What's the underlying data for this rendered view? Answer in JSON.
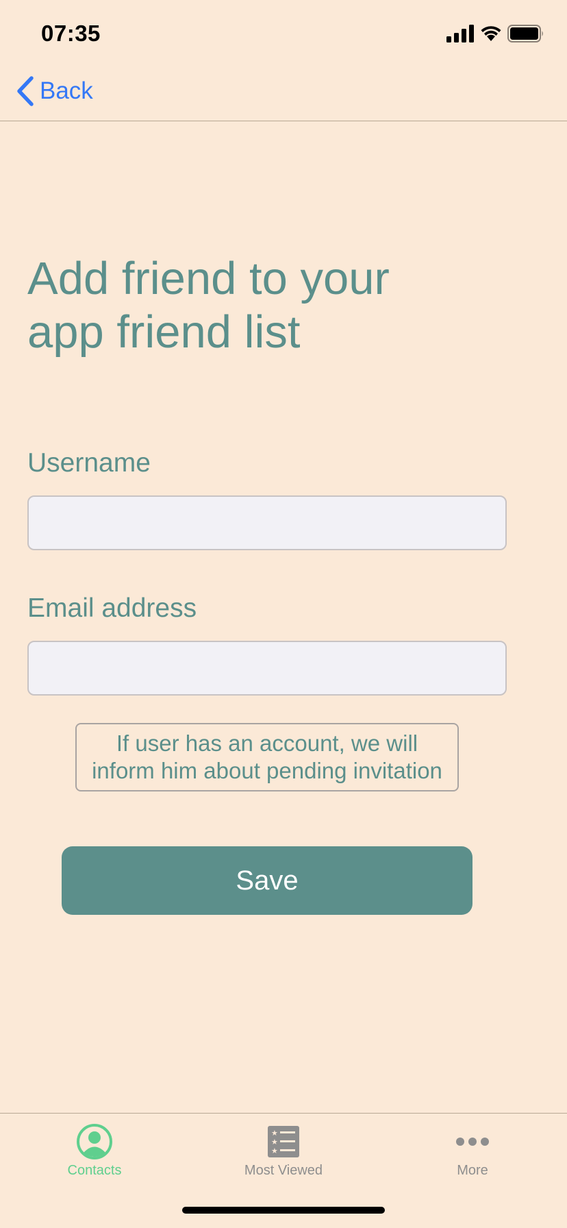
{
  "status_bar": {
    "time": "07:35"
  },
  "nav": {
    "back_label": "Back",
    "back_icon": "chevron-left-icon"
  },
  "form": {
    "title_line1": "Add friend to your",
    "title_line2": "app friend list",
    "username_label": "Username",
    "username_value": "",
    "email_label": "Email address",
    "email_value": "",
    "info_line1": "If user has an account, we will",
    "info_line2": "inform him about pending invitation",
    "save_label": "Save"
  },
  "tab_bar": {
    "items": [
      {
        "label": "Contacts",
        "icon": "person-circle-icon",
        "selected": true
      },
      {
        "label": "Most Viewed",
        "icon": "list-icon",
        "selected": false
      },
      {
        "label": "More",
        "icon": "more-icon",
        "selected": false
      }
    ]
  },
  "colors": {
    "background": "#fbe9d7",
    "accent": "#5c8f8b",
    "link": "#3478f6",
    "tab_selected": "#5fcf8e",
    "tab_unselected": "#8e8e8e"
  }
}
